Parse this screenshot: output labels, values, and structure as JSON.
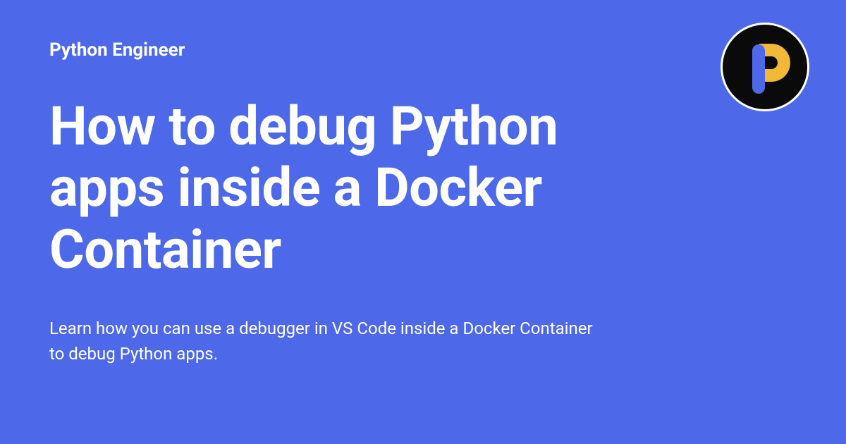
{
  "site_name": "Python Engineer",
  "title": "How to debug Python apps inside a Docker Container",
  "description": "Learn how you can use a debugger in VS Code inside a Docker Container to debug Python apps.",
  "colors": {
    "background": "#4D68E8",
    "text": "#ffffff",
    "logo_bg": "#0a0a0a",
    "logo_bar": "#4D68E8",
    "logo_arc": "#F0B938"
  }
}
